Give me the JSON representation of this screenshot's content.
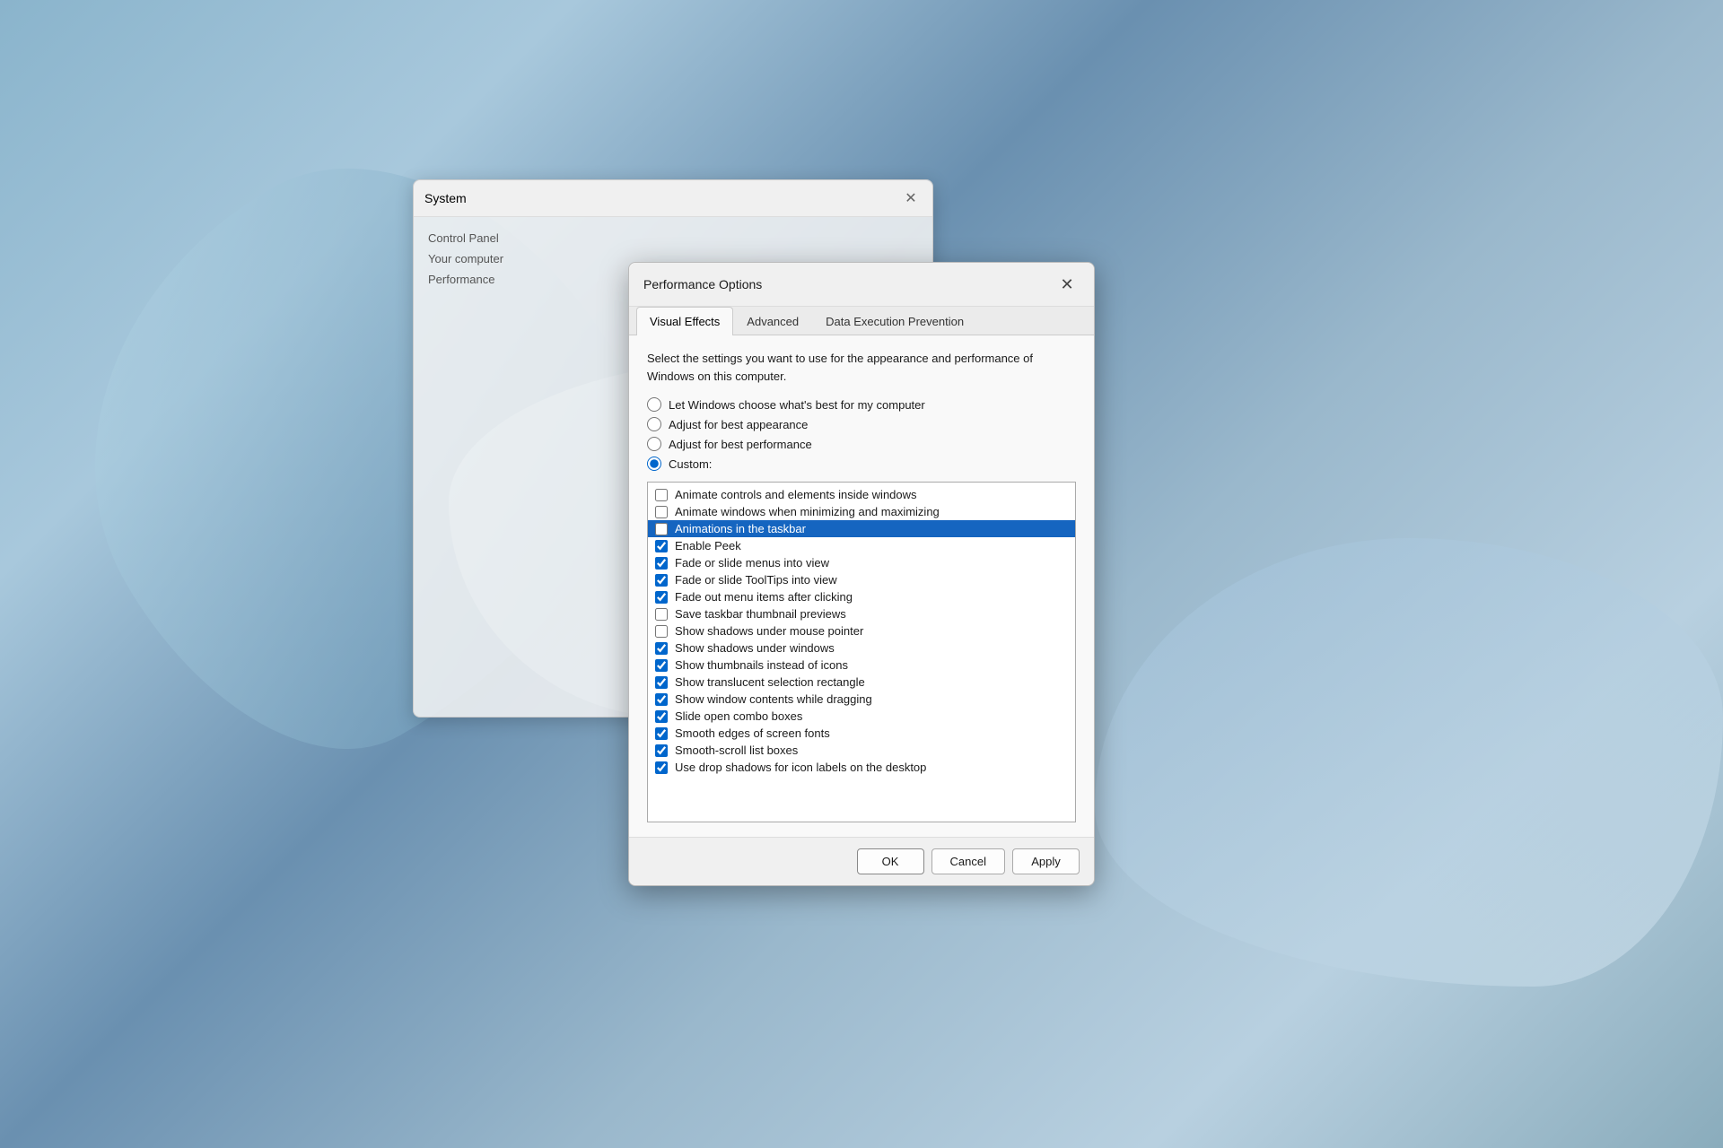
{
  "desktop": {
    "bg_color": "#7a9ab5"
  },
  "background_window": {
    "title": "System",
    "close_label": "✕",
    "content_lines": [
      "Control Panel",
      "Your computer",
      "Performance"
    ]
  },
  "dialog": {
    "title": "Performance Options",
    "close_label": "✕",
    "tabs": [
      {
        "id": "visual-effects",
        "label": "Visual Effects",
        "active": true
      },
      {
        "id": "advanced",
        "label": "Advanced",
        "active": false
      },
      {
        "id": "dep",
        "label": "Data Execution Prevention",
        "active": false
      }
    ],
    "description": "Select the settings you want to use for the appearance and\nperformance of Windows on this computer.",
    "radio_options": [
      {
        "id": "auto",
        "label": "Let Windows choose what's best for my computer",
        "checked": false
      },
      {
        "id": "best-appearance",
        "label": "Adjust for best appearance",
        "checked": false
      },
      {
        "id": "best-performance",
        "label": "Adjust for best performance",
        "checked": false
      },
      {
        "id": "custom",
        "label": "Custom:",
        "checked": true
      }
    ],
    "checkboxes": [
      {
        "label": "Animate controls and elements inside windows",
        "checked": false,
        "highlighted": false
      },
      {
        "label": "Animate windows when minimizing and maximizing",
        "checked": false,
        "highlighted": false
      },
      {
        "label": "Animations in the taskbar",
        "checked": false,
        "highlighted": true
      },
      {
        "label": "Enable Peek",
        "checked": true,
        "highlighted": false
      },
      {
        "label": "Fade or slide menus into view",
        "checked": true,
        "highlighted": false
      },
      {
        "label": "Fade or slide ToolTips into view",
        "checked": true,
        "highlighted": false
      },
      {
        "label": "Fade out menu items after clicking",
        "checked": true,
        "highlighted": false
      },
      {
        "label": "Save taskbar thumbnail previews",
        "checked": false,
        "highlighted": false
      },
      {
        "label": "Show shadows under mouse pointer",
        "checked": false,
        "highlighted": false
      },
      {
        "label": "Show shadows under windows",
        "checked": true,
        "highlighted": false
      },
      {
        "label": "Show thumbnails instead of icons",
        "checked": true,
        "highlighted": false
      },
      {
        "label": "Show translucent selection rectangle",
        "checked": true,
        "highlighted": false
      },
      {
        "label": "Show window contents while dragging",
        "checked": true,
        "highlighted": false
      },
      {
        "label": "Slide open combo boxes",
        "checked": true,
        "highlighted": false
      },
      {
        "label": "Smooth edges of screen fonts",
        "checked": true,
        "highlighted": false
      },
      {
        "label": "Smooth-scroll list boxes",
        "checked": true,
        "highlighted": false
      },
      {
        "label": "Use drop shadows for icon labels on the desktop",
        "checked": true,
        "highlighted": false
      }
    ],
    "buttons": {
      "ok": "OK",
      "cancel": "Cancel",
      "apply": "Apply"
    }
  }
}
